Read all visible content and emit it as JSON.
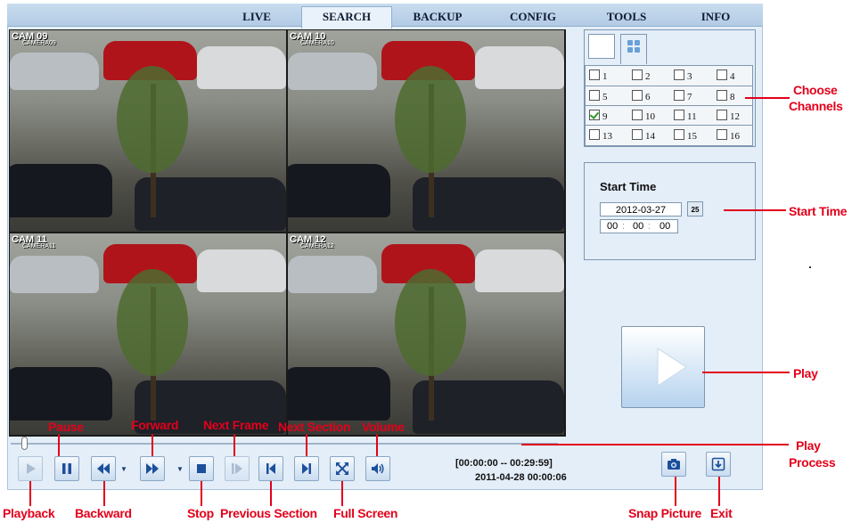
{
  "tabs": [
    {
      "label": "LIVE",
      "active": false
    },
    {
      "label": "SEARCH",
      "active": true
    },
    {
      "label": "BACKUP",
      "active": false
    },
    {
      "label": "CONFIG",
      "active": false
    },
    {
      "label": "TOOLS",
      "active": false
    },
    {
      "label": "INFO",
      "active": false
    }
  ],
  "cameras": [
    {
      "label": "CAM 09",
      "sub": "CAMERA09"
    },
    {
      "label": "CAM 10",
      "sub": "CAMERA10"
    },
    {
      "label": "CAM 11",
      "sub": "CAMERA11"
    },
    {
      "label": "CAM 12",
      "sub": "CAMERA12"
    }
  ],
  "channels": [
    {
      "num": "1",
      "checked": false
    },
    {
      "num": "2",
      "checked": false
    },
    {
      "num": "3",
      "checked": false
    },
    {
      "num": "4",
      "checked": false
    },
    {
      "num": "5",
      "checked": false
    },
    {
      "num": "6",
      "checked": false
    },
    {
      "num": "7",
      "checked": false
    },
    {
      "num": "8",
      "checked": false
    },
    {
      "num": "9",
      "checked": true
    },
    {
      "num": "10",
      "checked": false
    },
    {
      "num": "11",
      "checked": false
    },
    {
      "num": "12",
      "checked": false
    },
    {
      "num": "13",
      "checked": false
    },
    {
      "num": "14",
      "checked": false
    },
    {
      "num": "15",
      "checked": false
    },
    {
      "num": "16",
      "checked": false
    }
  ],
  "start_time": {
    "label": "Start Time",
    "date": "2012-03-27",
    "calendar_icon_text": "25",
    "hour": "00",
    "minute": "00",
    "second": "00"
  },
  "playback": {
    "range": "[00:00:00 -- 00:29:59]",
    "current": "2011-04-28 00:00:06",
    "progress": 0.02
  },
  "icons": {
    "playback": "play-icon",
    "pause": "pause-icon",
    "backward": "rewind-icon",
    "forward": "fast-forward-icon",
    "stop": "stop-icon",
    "next_frame": "next-frame-icon",
    "previous_section": "skip-back-icon",
    "next_section": "skip-forward-icon",
    "full_screen": "fullscreen-icon",
    "volume": "volume-icon",
    "snap": "camera-icon",
    "exit": "exit-icon"
  },
  "annotations": {
    "choose_channels_1": "Choose",
    "choose_channels_2": "Channels",
    "start_time": "Start Time",
    "play": "Play",
    "play_process_1": "Play",
    "play_process_2": "Process",
    "pause": "Pause",
    "forward": "Forward",
    "next_frame": "Next Frame",
    "next_section": "Next Section",
    "volume": "Volume",
    "playback": "Playback",
    "backward": "Backward",
    "stop": "Stop",
    "previous_section": "Previous Section",
    "full_screen": "Full Screen",
    "snap_picture": "Snap Picture",
    "exit": "Exit"
  },
  "colors": {
    "annotation": "#e3001b",
    "frame_bg": "#e4eef8",
    "button_icon": "#1c4f9c"
  }
}
